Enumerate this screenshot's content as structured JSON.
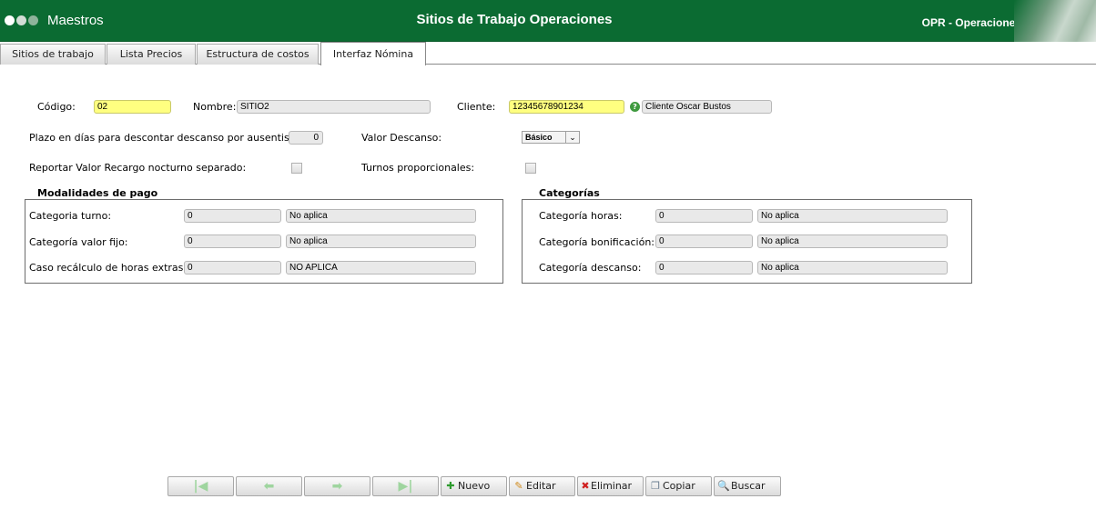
{
  "header": {
    "app_label": "Maestros",
    "title": "Sitios de Trabajo Operaciones",
    "module": "OPR - Operaciones"
  },
  "tabs": [
    {
      "label": "Sitios de trabajo"
    },
    {
      "label": "Lista Precios"
    },
    {
      "label": "Estructura de costos"
    },
    {
      "label": "Interfaz Nómina"
    }
  ],
  "form": {
    "codigo_label": "Código:",
    "codigo_value": "02",
    "nombre_label": "Nombre:",
    "nombre_value": "SITIO2",
    "cliente_label": "Cliente:",
    "cliente_value": "12345678901234",
    "cliente_help_icon": "help-icon",
    "cliente_name": "Cliente Oscar Bustos",
    "plazo_label": "Plazo en días para descontar descanso por ausentismo:",
    "plazo_value": "0",
    "valor_descanso_label": "Valor Descanso:",
    "valor_descanso_value": "Básico",
    "recargo_label": "Reportar Valor Recargo nocturno separado:",
    "turnos_label": "Turnos proporcionales:"
  },
  "modalidades": {
    "title": "Modalidades de pago",
    "rows": [
      {
        "label": "Categoria turno:",
        "code": "0",
        "desc": "No aplica"
      },
      {
        "label": "Categoría valor fijo:",
        "code": "0",
        "desc": "No aplica"
      },
      {
        "label": "Caso recálculo de horas extras:",
        "code": "0",
        "desc": "NO APLICA"
      }
    ]
  },
  "categorias": {
    "title": "Categorías",
    "rows": [
      {
        "label": "Categoría horas:",
        "code": "0",
        "desc": "No aplica"
      },
      {
        "label": "Categoría bonificación:",
        "code": "0",
        "desc": "No aplica"
      },
      {
        "label": "Categoría descanso:",
        "code": "0",
        "desc": "No aplica"
      }
    ]
  },
  "toolbar": {
    "nuevo": "Nuevo",
    "editar": "Editar",
    "eliminar": "Eliminar",
    "copiar": "Copiar",
    "buscar": "Buscar"
  },
  "colors": {
    "header_green": "#0b6b32",
    "required_yellow": "#ffff80"
  }
}
